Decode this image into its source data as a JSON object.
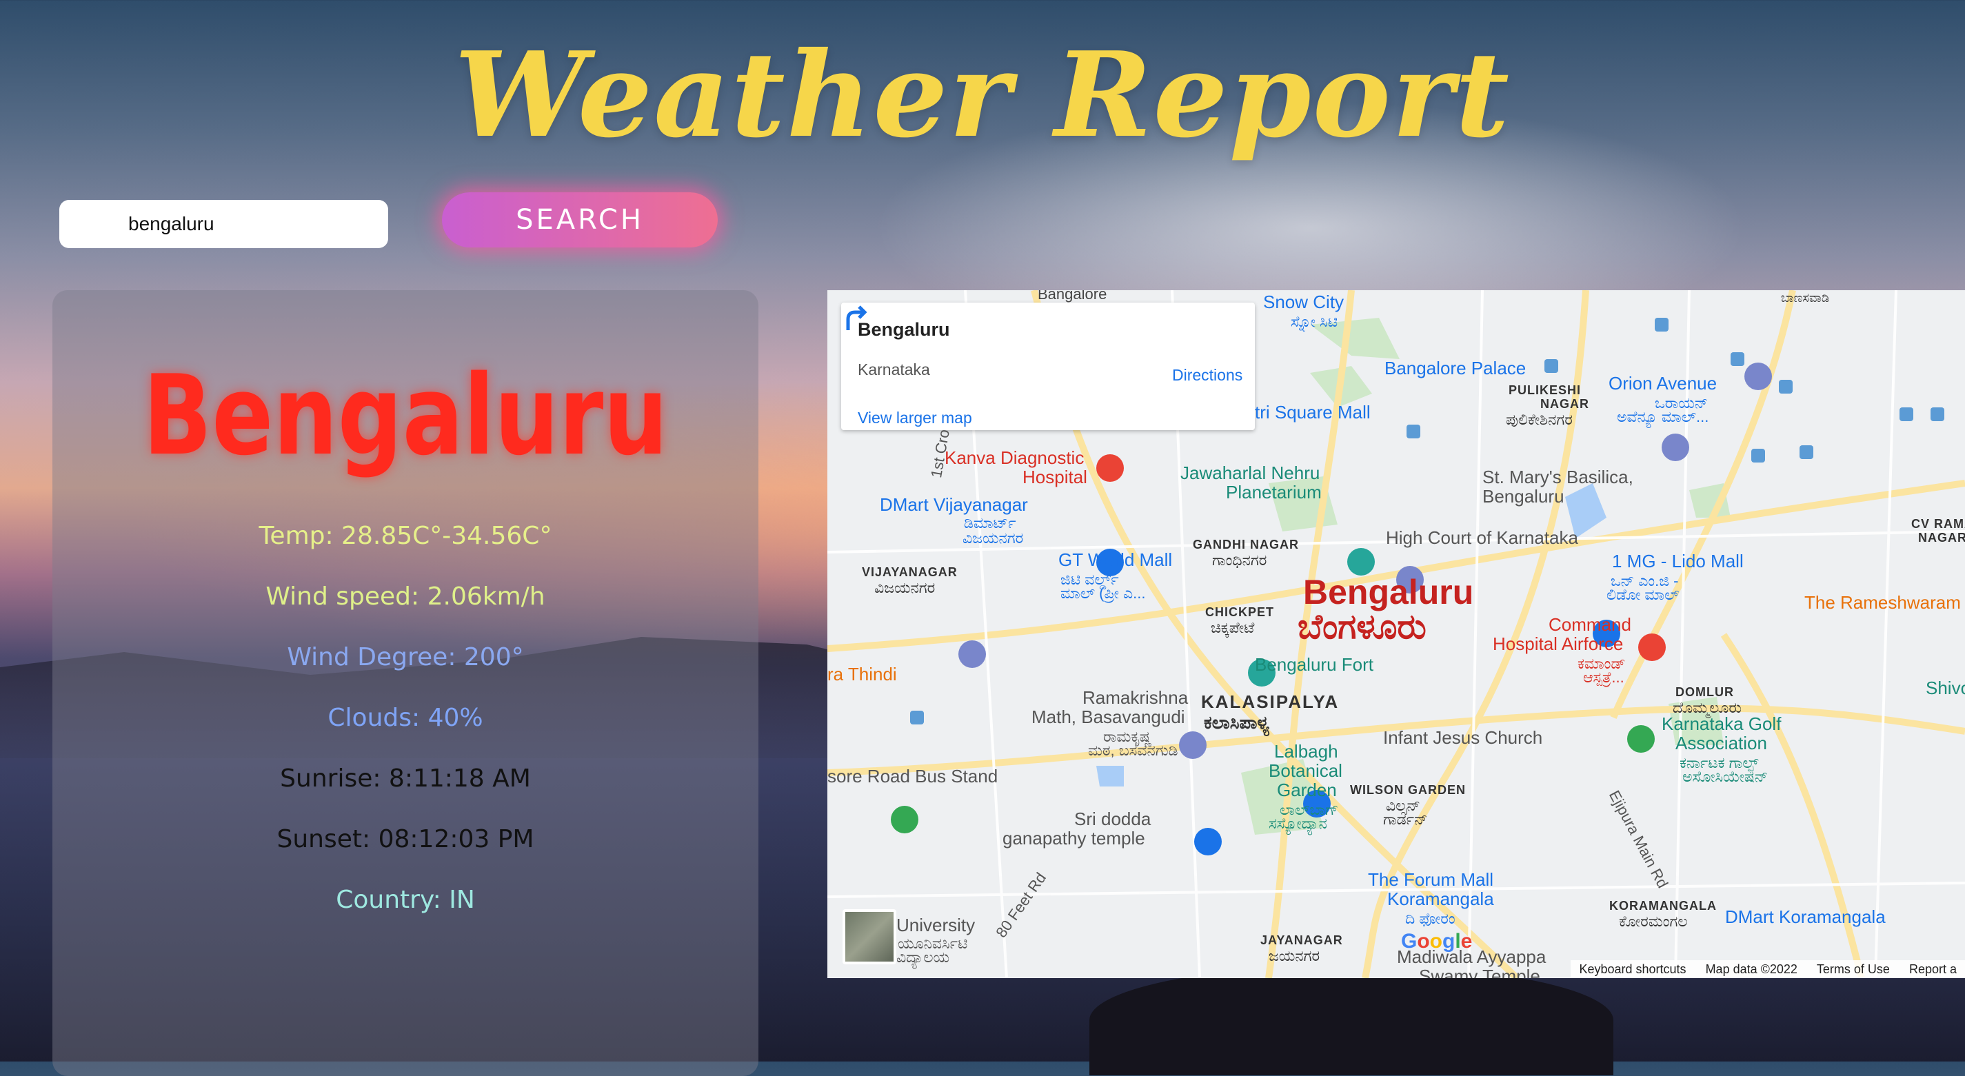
{
  "header": {
    "title": "Weather Report"
  },
  "search": {
    "value": "bengaluru",
    "button_label": "SEARCH"
  },
  "weather": {
    "city": "Bengaluru",
    "temp": "Temp: 28.85C°-34.56C°",
    "wind_speed": "Wind speed: 2.06km/h",
    "wind_degree": "Wind Degree: 200°",
    "clouds": "Clouds: 40%",
    "sunrise": "Sunrise: 8:11:18 AM",
    "sunset": "Sunset: 08:12:03 PM",
    "country": "Country: IN",
    "colors": {
      "city": "#ff2a1e",
      "temp": "#e6f08a",
      "wind_speed": "#dff08a",
      "wind_degree": "#8aa8f0",
      "clouds": "#7fa4f6",
      "sunrise": "#111111",
      "sunset": "#111111",
      "country": "#9ee8e0"
    }
  },
  "map": {
    "info": {
      "name": "Bengaluru",
      "region": "Karnataka",
      "larger_map": "View larger map",
      "directions": "Directions"
    },
    "labels": {
      "city_en": "Bengaluru",
      "city_kn": "ಬೆಂಗಳೂರು",
      "bangalore": "Bangalore",
      "snow_city": "Snow City",
      "snow_city_kn": "ಸ್ನೋ ಸಿಟಿ",
      "bangalore_palace": "Bangalore Palace",
      "pulikeshi": "PULIKESHI",
      "pulikeshi2": "NAGAR",
      "pulikeshi_kn": "ಪುಲಿಕೇಶಿನಗರ",
      "orion": "Orion Avenue",
      "orion_kn": "ಒರಾಯನ್",
      "orion_kn2": "ಅವೆನ್ಯೂ ಮಾಲ್...",
      "banaswadi_kn": "ಬಾಣಸವಾಡಿ",
      "tri_square": "tri Square Mall",
      "kanva": "Kanva Diagnostic",
      "kanva2": "Hospital",
      "jawaharlal": "Jawaharlal Nehru",
      "planetarium": "Planetarium",
      "st_marys": "St. Mary's Basilica,",
      "st_marys2": "Bengaluru",
      "dmart_vij": "DMart Vijayanagar",
      "dmart_vij_kn": "ಡಿಮಾರ್ಟ್",
      "dmart_vij_kn2": "ವಿಜಯನಗರ",
      "gandhi_nagar": "GANDHI NAGAR",
      "gandhi_nagar_kn": "ಗಾಂಧಿನಗರ",
      "high_court": "High Court of Karnataka",
      "one_mg": "1 MG - Lido Mall",
      "one_mg_kn": "ಒನ್ ಎಂ.ಜಿ -",
      "one_mg_kn2": "ಲಿಡೋ ಮಾಲ್",
      "cv_raman": "CV RAMA",
      "cv_raman2": "NAGAR",
      "vijayanagar": "VIJAYANAGAR",
      "vijayanagar_kn": "ವಿಜಯನಗರ",
      "gt_world": "GT World Mall",
      "gt_world_kn": "ಜಿಟಿ ವರ್ಲ್ಡ್",
      "gt_world_kn2": "ಮಾಲ್ (ಪ್ರೀ ಎ...",
      "chickpet": "CHICKPET",
      "chickpet_kn": "ಚಿಕ್ಕಪೇಟೆ",
      "rameshwaram": "The Rameshwaram",
      "command": "Command",
      "command2": "Hospital Airforce",
      "command_kn": "ಕಮಾಂಡ್",
      "command_kn2": "ಆಸ್ಪತ್ರೆ...",
      "ra_thindi": "ra Thindi",
      "bengaluru_fort": "Bengaluru Fort",
      "ramakrishna": "Ramakrishna",
      "ramakrishna2": "Math, Basavangudi",
      "ramakrishna_kn": "ರಾಮಕೃಷ್ಣ",
      "ramakrishna_kn2": "ಮಠ, ಬಸವನಗುಡಿ",
      "kalasipalya": "KALASIPALYA",
      "kalasipalya_kn": "ಕಲಾಸಿಪಾಳ್ಯ",
      "infant_jesus": "Infant Jesus Church",
      "domlur": "DOMLUR",
      "domlur_kn": "ದೊಮ್ಮಲೂರು",
      "shivoham": "Shivoh",
      "ktaka_golf": "Karnataka Golf",
      "ktaka_golf2": "Association",
      "ktaka_golf_kn": "ಕರ್ನಾಟಕ ಗಾಲ್ಫ್",
      "ktaka_golf_kn2": "ಅಸೋಸಿಯೇಷನ್",
      "mysore_road": "sore Road Bus Stand",
      "lalbagh": "Lalbagh",
      "lalbagh2": "Botanical",
      "lalbagh3": "Garden",
      "lalbagh_kn": "ಲಾಲ್‌ಬಾಗ್",
      "lalbagh_kn2": "ಸಸ್ಯೋದ್ಯಾನ",
      "wilson": "WILSON GARDEN",
      "wilson_kn": "ವಿಲ್ಸನ್",
      "wilson_kn2": "ಗಾರ್ಡನ್",
      "ejipura": "Ejipura Main Rd",
      "sri_dodda": "Sri dodda",
      "sri_dodda2": "ganapathy temple",
      "forum": "The Forum Mall",
      "forum2": "Koramangala",
      "forum_kn": "ದಿ ಫೋರಂ",
      "koramangala": "KORAMANGALA",
      "koramangala_kn": "ಕೋರಮಂಗಲ",
      "dmart_kor": "DMart Koramangala",
      "university": "University",
      "university_kn": "ಯೂನಿವರ್ಸಿಟಿ",
      "university_kn2": "ವಿದ್ಯಾಲಯ",
      "feet_rd": "80 Feet Rd",
      "first_cross": "1st Cro",
      "jayanagar": "JAYANAGAR",
      "jayanagar_kn": "ಜಯನಗರ",
      "madiwala": "Madiwala Ayyappa",
      "madiwala2": "Swamy Temple"
    },
    "footer": {
      "shortcuts": "Keyboard shortcuts",
      "map_data": "Map data ©2022",
      "terms": "Terms of Use",
      "report": "Report a"
    },
    "logo": "Google"
  }
}
